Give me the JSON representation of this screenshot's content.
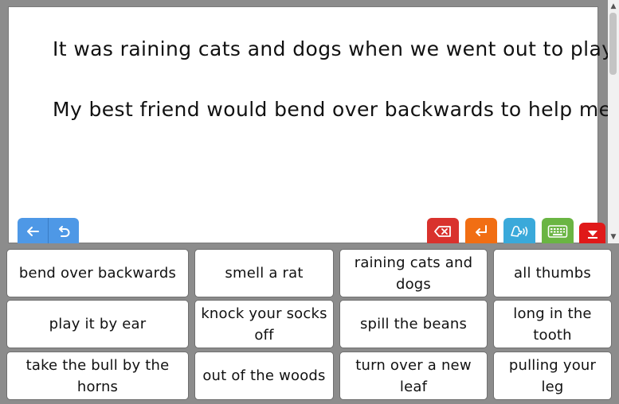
{
  "document": {
    "lines": [
      "It was raining cats and dogs when we went out to play.",
      "My best friend would bend over backwards to help me."
    ]
  },
  "toolbar": {
    "back": {
      "icon": "arrow-left-icon"
    },
    "undo": {
      "icon": "undo-icon"
    },
    "delete": {
      "icon": "backspace-icon",
      "color": "#d9322d"
    },
    "enter": {
      "icon": "enter-icon",
      "color": "#f16e13"
    },
    "speak": {
      "icon": "speak-icon",
      "color": "#3aa9da"
    },
    "keyboard": {
      "icon": "keyboard-icon",
      "color": "#6ab543"
    },
    "minimize": {
      "icon": "minimize-icon",
      "color": "#e01919"
    }
  },
  "phrases": [
    [
      "bend over backwards",
      "smell a rat",
      "raining cats and dogs",
      "all thumbs"
    ],
    [
      "play it by ear",
      "knock your socks off",
      "spill the beans",
      "long in the tooth"
    ],
    [
      "take the bull by the horns",
      "out of the woods",
      "turn over a new leaf",
      "pulling your leg"
    ]
  ]
}
